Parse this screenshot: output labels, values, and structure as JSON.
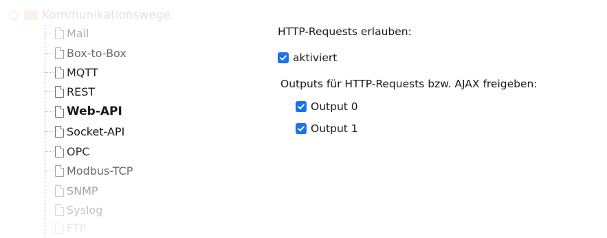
{
  "tree": {
    "parent_label": "Kommunikationswege",
    "items": [
      {
        "label": "Mail",
        "fade": 0.35,
        "selected": false
      },
      {
        "label": "Box-to-Box",
        "fade": 0.65,
        "selected": false
      },
      {
        "label": "MQTT",
        "fade": 0.95,
        "selected": false
      },
      {
        "label": "REST",
        "fade": 1.0,
        "selected": false
      },
      {
        "label": "Web-API",
        "fade": 1.0,
        "selected": true
      },
      {
        "label": "Socket-API",
        "fade": 1.0,
        "selected": false
      },
      {
        "label": "OPC",
        "fade": 0.9,
        "selected": false
      },
      {
        "label": "Modbus-TCP",
        "fade": 0.65,
        "selected": false
      },
      {
        "label": "SNMP",
        "fade": 0.4,
        "selected": false
      },
      {
        "label": "Syslog",
        "fade": 0.25,
        "selected": false
      },
      {
        "label": "FTP",
        "fade": 0.1,
        "selected": false
      }
    ]
  },
  "settings": {
    "http_heading": "HTTP-Requests erlauben:",
    "http_checkbox": {
      "label": "aktiviert",
      "checked": true
    },
    "outputs_heading": "Outputs für HTTP-Requests bzw. AJAX freigeben:",
    "outputs": [
      {
        "label": "Output 0",
        "checked": true
      },
      {
        "label": "Output 1",
        "checked": true
      }
    ]
  },
  "colors": {
    "checkbox_accent": "#1a73e8",
    "text": "#1a1a1a"
  }
}
